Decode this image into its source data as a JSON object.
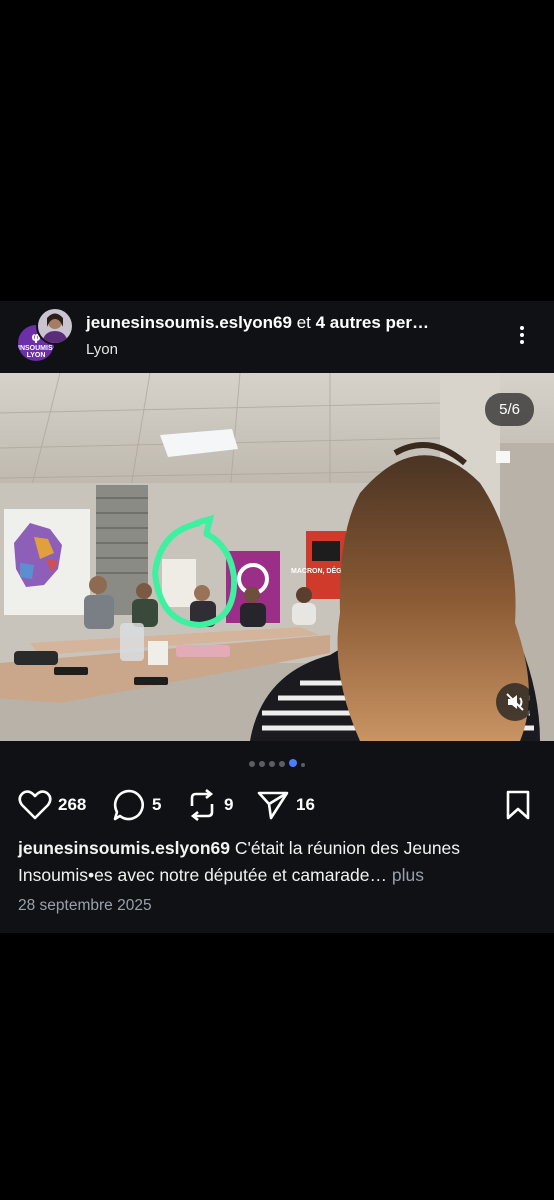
{
  "post": {
    "username": "jeunesinsoumis.eslyon69",
    "coauthors_suffix": " et ",
    "coauthors_text": "4 autres per…",
    "location": "Lyon",
    "avatar_logo_text": "INSOUMIS·ES LYON",
    "carousel_counter": "5/6",
    "carousel": {
      "total": 6,
      "current": 5
    },
    "stats": {
      "likes": "268",
      "comments": "5",
      "reposts": "9",
      "shares": "16"
    },
    "caption_user": "jeunesinsoumis.eslyon69",
    "caption_text": " C'était la réunion des Jeunes Insoumis•es avec notre députée et camarade… ",
    "caption_more": "plus",
    "date": "28 septembre 2025"
  },
  "photo_poster_text": "MACRON, DÉGAGE !",
  "icons": [
    "heart-icon",
    "comment-icon",
    "repost-icon",
    "share-icon",
    "bookmark-icon",
    "more-icon",
    "mute-icon"
  ],
  "colors": {
    "background": "#000000",
    "post_bg": "#0f1115",
    "accent": "#4d7cff",
    "annotation": "#3ef0a0"
  }
}
